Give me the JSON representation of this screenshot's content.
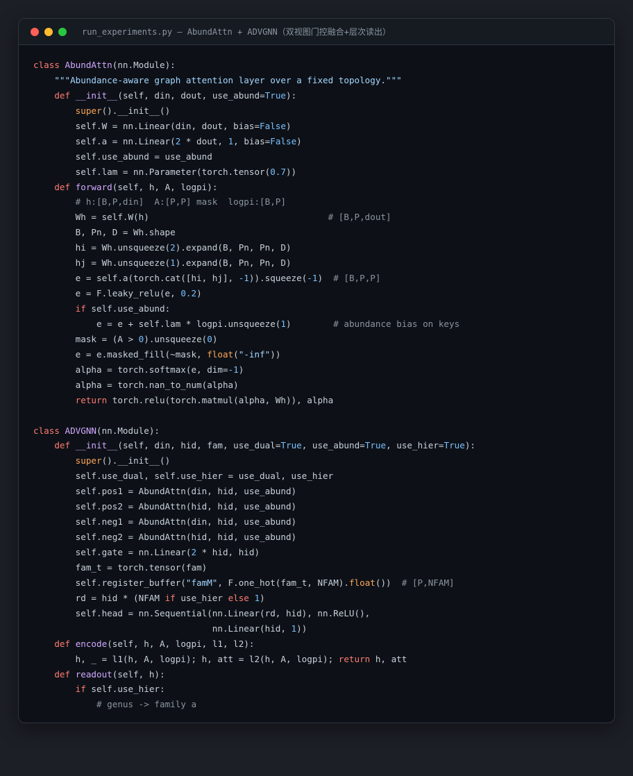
{
  "window": {
    "title": "run_experiments.py — AbundAttn + ADVGNN（双视图门控融合+层次读出）"
  },
  "colors": {
    "keyword": "#ff7b72",
    "name": "#d2a8ff",
    "string": "#a5d6ff",
    "number": "#79c0ff",
    "builtin": "#ffa657",
    "comment": "#8b949e",
    "text": "#c9d1d9",
    "background": "#0d1117"
  },
  "code_lines": [
    [
      [
        "k",
        "class"
      ],
      [
        "",
        "AbundAttn("
      ]
    ],
    [
      [
        "k",
        "class "
      ],
      [
        "c",
        "AbundAttn"
      ],
      [
        "",
        "(nn.Module):"
      ]
    ],
    [
      [
        "",
        "    "
      ],
      [
        "s",
        "\"\"\"Abundance-aware graph attention layer over a fixed topology.\"\"\""
      ]
    ],
    [
      [
        "",
        "    "
      ],
      [
        "k",
        "def "
      ],
      [
        "c",
        "__init__"
      ],
      [
        "",
        "(self, din, dout, use_abund="
      ],
      [
        "n",
        "True"
      ],
      [
        "",
        "):"
      ]
    ],
    [
      [
        "",
        "        "
      ],
      [
        "b",
        "super"
      ],
      [
        "",
        "().__init__()"
      ]
    ],
    [
      [
        "",
        "        self.W = nn.Linear(din, dout, bias="
      ],
      [
        "n",
        "False"
      ],
      [
        "",
        ")"
      ]
    ],
    [
      [
        "",
        "        self.a = nn.Linear("
      ],
      [
        "n",
        "2"
      ],
      [
        "",
        " * dout, "
      ],
      [
        "n",
        "1"
      ],
      [
        "",
        ", bias="
      ],
      [
        "n",
        "False"
      ],
      [
        "",
        ")"
      ]
    ],
    [
      [
        "",
        "        self.use_abund = use_abund"
      ]
    ],
    [
      [
        "",
        "        self.lam = nn.Parameter(torch.tensor("
      ],
      [
        "n",
        "0.7"
      ],
      [
        "",
        "))"
      ]
    ],
    [
      [
        "",
        "    "
      ],
      [
        "k",
        "def "
      ],
      [
        "c",
        "forward"
      ],
      [
        "",
        "(self, h, A, logpi):"
      ]
    ],
    [
      [
        "",
        "        "
      ],
      [
        "m",
        "# h:[B,P,din]  A:[P,P] mask  logpi:[B,P]"
      ]
    ],
    [
      [
        "",
        "        Wh = self.W(h)                                  "
      ],
      [
        "m",
        "# [B,P,dout]"
      ]
    ],
    [
      [
        "",
        "        B, Pn, D = Wh.shape"
      ]
    ],
    [
      [
        "",
        "        hi = Wh.unsqueeze("
      ],
      [
        "n",
        "2"
      ],
      [
        "",
        ").expand(B, Pn, Pn, D)"
      ]
    ],
    [
      [
        "",
        "        hj = Wh.unsqueeze("
      ],
      [
        "n",
        "1"
      ],
      [
        "",
        ").expand(B, Pn, Pn, D)"
      ]
    ],
    [
      [
        "",
        "        e = self.a(torch.cat([hi, hj], "
      ],
      [
        "n",
        "-1"
      ],
      [
        "",
        ")).squeeze("
      ],
      [
        "n",
        "-1"
      ],
      [
        "",
        ")  "
      ],
      [
        "m",
        "# [B,P,P]"
      ]
    ],
    [
      [
        "",
        "        e = F.leaky_relu(e, "
      ],
      [
        "n",
        "0.2"
      ],
      [
        "",
        ")"
      ]
    ],
    [
      [
        "",
        "        "
      ],
      [
        "k",
        "if "
      ],
      [
        "",
        "self.use_abund:"
      ]
    ],
    [
      [
        "",
        "            e = e + self.lam * logpi.unsqueeze("
      ],
      [
        "n",
        "1"
      ],
      [
        "",
        ")        "
      ],
      [
        "m",
        "# abundance bias on keys"
      ]
    ],
    [
      [
        "",
        "        mask = (A > "
      ],
      [
        "n",
        "0"
      ],
      [
        "",
        ").unsqueeze("
      ],
      [
        "n",
        "0"
      ],
      [
        "",
        ")"
      ]
    ],
    [
      [
        "",
        "        e = e.masked_fill(~mask, "
      ],
      [
        "b",
        "float"
      ],
      [
        "",
        "("
      ],
      [
        "s",
        "\"-inf\""
      ],
      [
        "",
        "))"
      ]
    ],
    [
      [
        "",
        "        alpha = torch.softmax(e, dim="
      ],
      [
        "n",
        "-1"
      ],
      [
        "",
        ")"
      ]
    ],
    [
      [
        "",
        "        alpha = torch.nan_to_num(alpha)"
      ]
    ],
    [
      [
        "",
        "        "
      ],
      [
        "k",
        "return "
      ],
      [
        "",
        "torch.relu(torch.matmul(alpha, Wh)), alpha"
      ]
    ],
    [
      [
        "",
        ""
      ]
    ],
    [
      [
        "k",
        "class "
      ],
      [
        "c",
        "ADVGNN"
      ],
      [
        "",
        "(nn.Module):"
      ]
    ],
    [
      [
        "",
        "    "
      ],
      [
        "k",
        "def "
      ],
      [
        "c",
        "__init__"
      ],
      [
        "",
        "(self, din, hid, fam, use_dual="
      ],
      [
        "n",
        "True"
      ],
      [
        "",
        ", use_abund="
      ],
      [
        "n",
        "True"
      ],
      [
        "",
        ", use_hier="
      ],
      [
        "n",
        "True"
      ],
      [
        "",
        "):"
      ]
    ],
    [
      [
        "",
        "        "
      ],
      [
        "b",
        "super"
      ],
      [
        "",
        "().__init__()"
      ]
    ],
    [
      [
        "",
        "        self.use_dual, self.use_hier = use_dual, use_hier"
      ]
    ],
    [
      [
        "",
        "        self.pos1 = AbundAttn(din, hid, use_abund)"
      ]
    ],
    [
      [
        "",
        "        self.pos2 = AbundAttn(hid, hid, use_abund)"
      ]
    ],
    [
      [
        "",
        "        self.neg1 = AbundAttn(din, hid, use_abund)"
      ]
    ],
    [
      [
        "",
        "        self.neg2 = AbundAttn(hid, hid, use_abund)"
      ]
    ],
    [
      [
        "",
        "        self.gate = nn.Linear("
      ],
      [
        "n",
        "2"
      ],
      [
        "",
        " * hid, hid)"
      ]
    ],
    [
      [
        "",
        "        fam_t = torch.tensor(fam)"
      ]
    ],
    [
      [
        "",
        "        self.register_buffer("
      ],
      [
        "s",
        "\"famM\""
      ],
      [
        "",
        ", F.one_hot(fam_t, NFAM)."
      ],
      [
        "b",
        "float"
      ],
      [
        "",
        "())  "
      ],
      [
        "m",
        "# [P,NFAM]"
      ]
    ],
    [
      [
        "",
        "        rd = hid * (NFAM "
      ],
      [
        "k",
        "if "
      ],
      [
        "",
        "use_hier "
      ],
      [
        "k",
        "else "
      ],
      [
        "n",
        "1"
      ],
      [
        "",
        ")"
      ]
    ],
    [
      [
        "",
        "        self.head = nn.Sequential(nn.Linear(rd, hid), nn.ReLU(),"
      ]
    ],
    [
      [
        "",
        "                                  nn.Linear(hid, "
      ],
      [
        "n",
        "1"
      ],
      [
        "",
        "))"
      ]
    ],
    [
      [
        "",
        "    "
      ],
      [
        "k",
        "def "
      ],
      [
        "c",
        "encode"
      ],
      [
        "",
        "(self, h, A, logpi, l1, l2):"
      ]
    ],
    [
      [
        "",
        "        h, _ = l1(h, A, logpi); h, att = l2(h, A, logpi); "
      ],
      [
        "k",
        "return "
      ],
      [
        "",
        "h, att"
      ]
    ],
    [
      [
        "",
        "    "
      ],
      [
        "k",
        "def "
      ],
      [
        "c",
        "readout"
      ],
      [
        "",
        "(self, h):"
      ]
    ],
    [
      [
        "",
        "        "
      ],
      [
        "k",
        "if "
      ],
      [
        "",
        "self.use_hier:"
      ]
    ],
    [
      [
        "",
        "            "
      ],
      [
        "m",
        "# genus -> family a"
      ]
    ]
  ]
}
